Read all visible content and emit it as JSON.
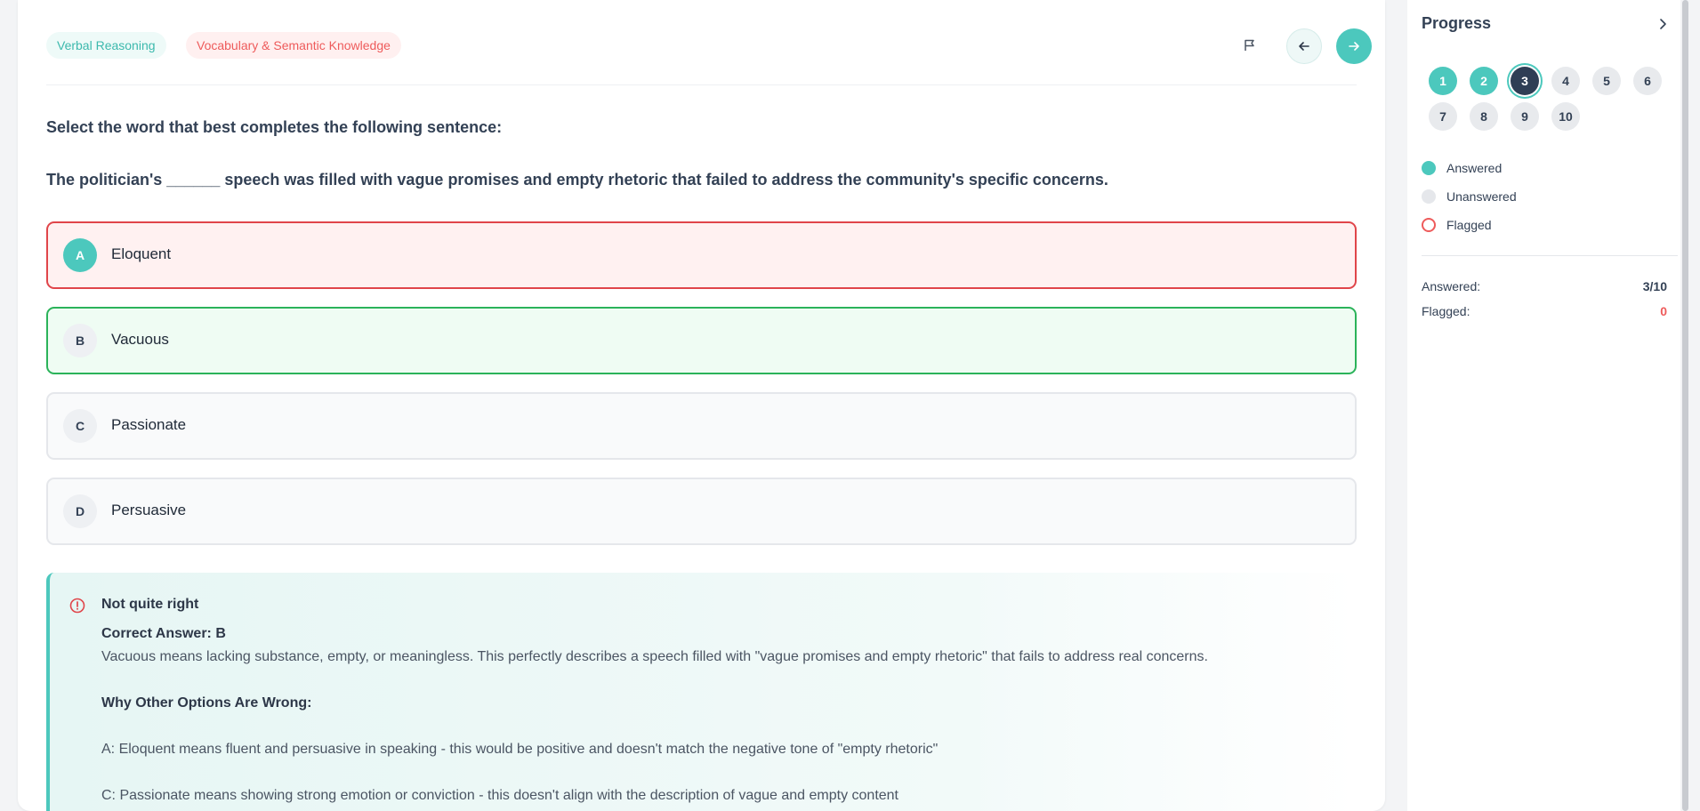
{
  "header": {
    "category_tag": "Verbal Reasoning",
    "subcategory_tag": "Vocabulary & Semantic Knowledge",
    "flag_icon": "flag-icon",
    "prev_icon": "arrow-left-icon",
    "next_icon": "arrow-right-icon"
  },
  "question": {
    "prompt": "Select the word that best completes the following sentence:",
    "text": "The politician's ______ speech was filled with vague promises and empty rhetoric that failed to address the community's specific concerns."
  },
  "options": [
    {
      "letter": "A",
      "label": "Eloquent",
      "state": "selected-incorrect"
    },
    {
      "letter": "B",
      "label": "Vacuous",
      "state": "correct"
    },
    {
      "letter": "C",
      "label": "Passionate",
      "state": "default"
    },
    {
      "letter": "D",
      "label": "Persuasive",
      "state": "default"
    }
  ],
  "feedback": {
    "icon": "alert-circle-icon",
    "title": "Not quite right",
    "correct_answer": "Correct Answer: B",
    "explanation": "Vacuous means lacking substance, empty, or meaningless. This perfectly describes a speech filled with \"vague promises and empty rhetoric\" that fails to address real concerns.",
    "why_heading": "Why Other Options Are Wrong:",
    "why_a": "A: Eloquent means fluent and persuasive in speaking - this would be positive and doesn't match the negative tone of \"empty rhetoric\"",
    "why_c": "C: Passionate means showing strong emotion or conviction - this doesn't align with the description of vague and empty content"
  },
  "sidebar": {
    "title": "Progress",
    "collapse_icon": "chevron-right-icon",
    "questions": [
      {
        "num": "1",
        "state": "answered"
      },
      {
        "num": "2",
        "state": "answered"
      },
      {
        "num": "3",
        "state": "current"
      },
      {
        "num": "4",
        "state": "unanswered"
      },
      {
        "num": "5",
        "state": "unanswered"
      },
      {
        "num": "6",
        "state": "unanswered"
      },
      {
        "num": "7",
        "state": "unanswered"
      },
      {
        "num": "8",
        "state": "unanswered"
      },
      {
        "num": "9",
        "state": "unanswered"
      },
      {
        "num": "10",
        "state": "unanswered"
      }
    ],
    "legend": {
      "answered": "Answered",
      "unanswered": "Unanswered",
      "flagged": "Flagged"
    },
    "stats": {
      "answered_label": "Answered:",
      "answered_value": "3/10",
      "flagged_label": "Flagged:",
      "flagged_value": "0"
    }
  },
  "colors": {
    "accent": "#4cc8bd",
    "incorrect": "#e0454a",
    "correct": "#2bb35a",
    "current": "#2f3e55",
    "flagged": "#ee5b5b"
  }
}
